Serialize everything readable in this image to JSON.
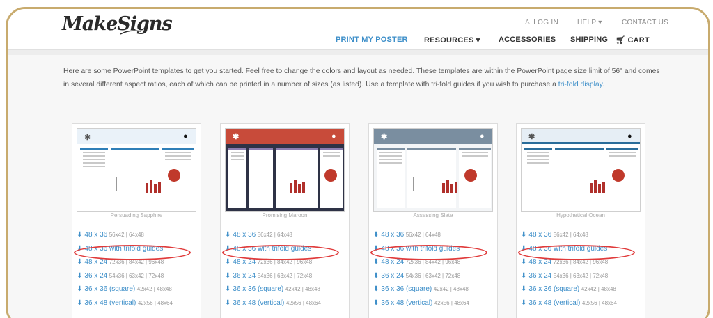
{
  "brand": {
    "logo_text": "MakeSigns"
  },
  "utility_nav": {
    "login": "LOG IN",
    "help": "HELP",
    "contact": "CONTACT US"
  },
  "main_nav": {
    "print_my_poster": "PRINT MY POSTER",
    "resources": "RESOURCES",
    "accessories": "ACCESSORIES",
    "shipping": "SHIPPING",
    "cart": "CART"
  },
  "intro": {
    "text": "Here are some PowerPoint templates to get you started. Feel free to change the colors and layout as needed. These templates are within the PowerPoint page size limit of 56\" and comes in several different aspect ratios, each of which can be printed in a number of sizes (as listed). Use a template with tri-fold guides if you wish to purchase a ",
    "link": "tri-fold display",
    "end": "."
  },
  "templates": [
    {
      "name": "Persuading Sapphire",
      "sizes": [
        {
          "main": "48 x 36",
          "extra": "56x42 | 64x48"
        },
        {
          "main": "48 x 36 with trifold guides",
          "extra": ""
        },
        {
          "main": "48 x 24",
          "extra": "72x36 | 84x42 | 96x48"
        },
        {
          "main": "36 x 24",
          "extra": "54x36 | 63x42 | 72x48"
        },
        {
          "main": "36 x 36 (square)",
          "extra": "42x42 | 48x48"
        },
        {
          "main": "36 x 48 (vertical)",
          "extra": "42x56 | 48x64"
        }
      ]
    },
    {
      "name": "Promising Maroon",
      "sizes": [
        {
          "main": "48 x 36",
          "extra": "56x42 | 64x48"
        },
        {
          "main": "48 x 36 with trifold guides",
          "extra": ""
        },
        {
          "main": "48 x 24",
          "extra": "72x36 | 84x42 | 96x48"
        },
        {
          "main": "36 x 24",
          "extra": "54x36 | 63x42 | 72x48"
        },
        {
          "main": "36 x 36 (square)",
          "extra": "42x42 | 48x48"
        },
        {
          "main": "36 x 48 (vertical)",
          "extra": "42x56 | 48x64"
        }
      ]
    },
    {
      "name": "Assessing Slate",
      "sizes": [
        {
          "main": "48 x 36",
          "extra": "56x42 | 64x48"
        },
        {
          "main": "48 x 36 with trifold guides",
          "extra": ""
        },
        {
          "main": "48 x 24",
          "extra": "72x36 | 84x42 | 96x48"
        },
        {
          "main": "36 x 24",
          "extra": "54x36 | 63x42 | 72x48"
        },
        {
          "main": "36 x 36 (square)",
          "extra": "42x42 | 48x48"
        },
        {
          "main": "36 x 48 (vertical)",
          "extra": "42x56 | 48x64"
        }
      ]
    },
    {
      "name": "Hypothetical Ocean",
      "sizes": [
        {
          "main": "48 x 36",
          "extra": "56x42 | 64x48"
        },
        {
          "main": "48 x 36 with trifold guides",
          "extra": ""
        },
        {
          "main": "48 x 24",
          "extra": "72x36 | 84x42 | 96x48"
        },
        {
          "main": "36 x 24",
          "extra": "54x36 | 63x42 | 72x48"
        },
        {
          "main": "36 x 36 (square)",
          "extra": "42x42 | 48x48"
        },
        {
          "main": "36 x 48 (vertical)",
          "extra": "42x56 | 48x64"
        }
      ]
    }
  ],
  "colors": {
    "accent_blue": "#3e8fc9",
    "frame_gold": "#c8ab6e",
    "highlight_red": "#e03a3a",
    "poster_blue": "#2f7fb8",
    "poster_maroon": "#2e3246",
    "poster_slate": "#7a8ea0",
    "poster_ocean": "#2a6d9a"
  },
  "icons": {
    "download": "download-cloud-icon",
    "user": "user-icon",
    "cart": "cart-icon",
    "chevron": "chevron-down-icon"
  }
}
